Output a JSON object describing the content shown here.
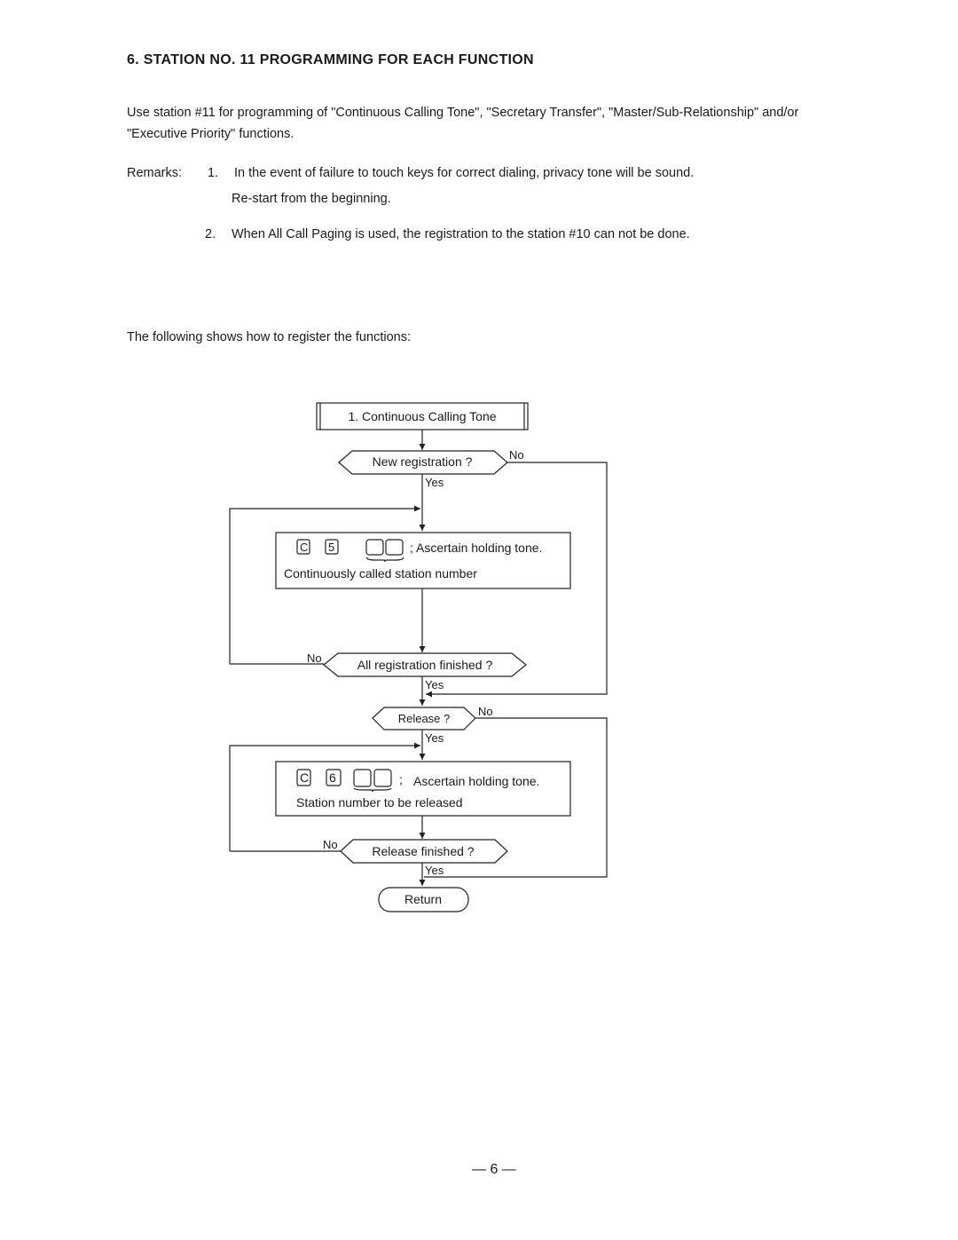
{
  "section": {
    "title": "6.  STATION NO. 11  PROGRAMMING FOR EACH FUNCTION",
    "intro_line1": "Use station #11 for programming of \"Continuous Calling Tone\", \"Secretary Transfer\", \"Master/Sub-Relationship\" and/or",
    "intro_line2": "\"Executive Priority\" functions."
  },
  "remarks": {
    "label": "Remarks:",
    "items": [
      {
        "num": "1.",
        "line1": "In the event of failure to touch keys for correct dialing, privacy tone will be sound.",
        "line2": "Re-start from the beginning."
      },
      {
        "num": "2.",
        "line1": "When All Call Paging is used, the registration to the station #10 can not be done."
      }
    ]
  },
  "following": "The following shows how to register the functions:",
  "flowchart": {
    "start": "1.  Continuous Calling Tone",
    "decision_new": "New registration ?",
    "yes": "Yes",
    "no": "No",
    "register_keys": [
      "C",
      "5"
    ],
    "register_action": ";  Ascertain holding tone.",
    "register_note": "Continuously called station number",
    "decision_all_finished": "All registration finished ?",
    "decision_release": "Release ?",
    "release_keys": [
      "C",
      "6"
    ],
    "release_action": "Ascertain holding tone.",
    "release_note": "Station number to be released",
    "decision_release_finished": "Release finished ?",
    "end": "Return"
  },
  "page_number": "— 6 —"
}
